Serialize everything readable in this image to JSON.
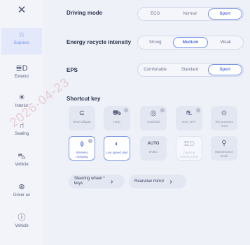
{
  "sidebar": {
    "close_glyph": "✕",
    "items": [
      {
        "label": "Express",
        "icon": "star-icon",
        "glyph": "☆",
        "active": true
      },
      {
        "label": "Exterior",
        "icon": "car-light-icon",
        "glyph": "≣D",
        "active": false
      },
      {
        "label": "Interior",
        "icon": "interior-light-icon",
        "glyph": "☀",
        "active": false
      },
      {
        "label": "Seating",
        "icon": "seat-icon",
        "glyph": "⑁",
        "active": false
      },
      {
        "label": "Vehicle",
        "icon": "car-icon",
        "glyph": "⛍",
        "active": false
      },
      {
        "label": "Driver as",
        "icon": "steering-wheel-icon",
        "glyph": "⊛",
        "active": false
      },
      {
        "label": "Vehicle",
        "icon": "info-icon",
        "glyph": "ⓘ",
        "active": false
      }
    ]
  },
  "driving_mode": {
    "label": "Driving mode",
    "options": [
      "ECO",
      "Normal",
      "Sport"
    ],
    "selected": "Sport"
  },
  "energy_recycle": {
    "label": "Energy recycle intensity",
    "options": [
      "Strong",
      "Medium",
      "Weak"
    ],
    "selected": "Medium"
  },
  "eps": {
    "label": "EPS",
    "options": [
      "Comfortable",
      "Standard",
      "Sport"
    ],
    "selected": "Sport"
  },
  "shortcut": {
    "title": "Shortcut key",
    "tiles": [
      {
        "label": "Rear tailgate",
        "icon": "tailgate-icon",
        "glyph": "⊆",
        "state": "normal",
        "info": false
      },
      {
        "label": "HDC",
        "icon": "hdc-icon",
        "glyph": "⛟",
        "state": "normal",
        "info": true
      },
      {
        "label": "Autohold",
        "icon": "autohold-icon",
        "glyph": "◎",
        "state": "normal",
        "info": true
      },
      {
        "label": "ESC OFF",
        "icon": "esc-off-icon",
        "glyph": "⛐",
        "state": "normal",
        "info": true
      },
      {
        "label": "Tire pressure reset",
        "icon": "tire-pressure-icon",
        "glyph": "⊙",
        "state": "normal",
        "info": false
      },
      {
        "label": "Wireless charging",
        "icon": "wireless-charging-icon",
        "glyph": "ϕ",
        "state": "on",
        "info": true
      },
      {
        "label": "Low speed alert",
        "icon": "low-speed-alert-icon",
        "glyph": "◐",
        "state": "on",
        "info": false
      },
      {
        "label": "EVBC",
        "icon": "evbc-icon",
        "glyph": "AUTO",
        "state": "normal",
        "info": false
      },
      {
        "label": "Daytime running lamp",
        "icon": "daytime-running-lamp-icon",
        "glyph": "≣D",
        "state": "faded",
        "info": false
      },
      {
        "label": "Maintenance mode",
        "icon": "wrench-icon",
        "glyph": "⚲",
        "state": "normal",
        "info": false
      }
    ]
  },
  "links": {
    "steering_wheel_keys": "Steering wheel * keys",
    "rearview_mirror": "Rearview mirror",
    "chevron": "›"
  },
  "watermark": "2026-04-23"
}
